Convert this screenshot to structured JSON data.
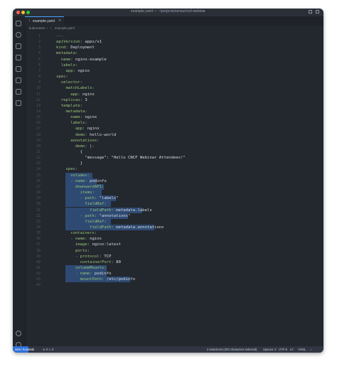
{
  "window": {
    "title": "example.yaml — ~/projects/sensu/cncf-webinar"
  },
  "tab": {
    "label": "example.yaml",
    "icon": "yaml-file-icon"
  },
  "breadcrumb": {
    "items": [
      "kubernetes",
      "example.yaml"
    ]
  },
  "code_lines": [
    {
      "n": "1",
      "k": "---",
      "v": ""
    },
    {
      "n": "2",
      "k": "apiVersion:",
      "v": " apps/v1"
    },
    {
      "n": "3",
      "k": "kind:",
      "v": " Deployment"
    },
    {
      "n": "4",
      "k": "metadata:",
      "v": ""
    },
    {
      "n": "5",
      "k": "  name:",
      "v": " nginx-example"
    },
    {
      "n": "6",
      "k": "  labels:",
      "v": ""
    },
    {
      "n": "7",
      "k": "    app:",
      "v": " nginx"
    },
    {
      "n": "8",
      "k": "spec:",
      "v": ""
    },
    {
      "n": "9",
      "k": "  selector:",
      "v": ""
    },
    {
      "n": "10",
      "k": "    matchLabels:",
      "v": ""
    },
    {
      "n": "11",
      "k": "      app:",
      "v": " nginx"
    },
    {
      "n": "12",
      "k": "  replicas:",
      "v": " 3"
    },
    {
      "n": "13",
      "k": "  template:",
      "v": ""
    },
    {
      "n": "14",
      "k": "    metadata:",
      "v": ""
    },
    {
      "n": "15",
      "k": "      name:",
      "v": " nginx"
    },
    {
      "n": "16",
      "k": "      labels:",
      "v": ""
    },
    {
      "n": "17",
      "k": "        app:",
      "v": " nginx"
    },
    {
      "n": "18",
      "k": "        demo:",
      "v": " hello-world"
    },
    {
      "n": "19",
      "k": "      annotations:",
      "v": ""
    },
    {
      "n": "20",
      "k": "        demo:",
      "v": " |-"
    },
    {
      "n": "21",
      "k": "",
      "v": "          {"
    },
    {
      "n": "22",
      "k": "",
      "v": "            \"message\": \"Hello CNCF Webinar Attendees!\""
    },
    {
      "n": "23",
      "k": "",
      "v": "          }"
    },
    {
      "n": "24",
      "k": "    spec:",
      "v": ""
    },
    {
      "n": "25",
      "k": "      volumes:",
      "v": ""
    },
    {
      "n": "26",
      "k": "      - name:",
      "v": " podinfo"
    },
    {
      "n": "27",
      "k": "        downwardAPI:",
      "v": ""
    },
    {
      "n": "28",
      "k": "          items:",
      "v": ""
    },
    {
      "n": "29",
      "k": "          - path:",
      "v": " \"labels\""
    },
    {
      "n": "30",
      "k": "            fieldRef:",
      "v": ""
    },
    {
      "n": "31",
      "k": "              fieldPath:",
      "v": " metadata.labels"
    },
    {
      "n": "32",
      "k": "          - path:",
      "v": " \"annotations\""
    },
    {
      "n": "33",
      "k": "            fieldRef:",
      "v": ""
    },
    {
      "n": "34",
      "k": "              fieldPath:",
      "v": " metadata.annotations"
    },
    {
      "n": "35",
      "k": "      containers:",
      "v": ""
    },
    {
      "n": "36",
      "k": "      - name:",
      "v": " nginx"
    },
    {
      "n": "37",
      "k": "        image:",
      "v": " nginx:latest"
    },
    {
      "n": "38",
      "k": "        ports:",
      "v": ""
    },
    {
      "n": "39",
      "k": "        - protocol:",
      "v": " TCP"
    },
    {
      "n": "40",
      "k": "          containerPort:",
      "v": " 80"
    },
    {
      "n": "41",
      "k": "        volumeMounts:",
      "v": ""
    },
    {
      "n": "42",
      "k": "        - name:",
      "v": " podinfo"
    },
    {
      "n": "43",
      "k": "          mountPath:",
      "v": " /etc/podinfo"
    },
    {
      "n": "44",
      "k": "",
      "v": ""
    }
  ],
  "status": {
    "remote": "SSH: homelab",
    "problems": "⊘ 0 ⚠ 0",
    "selection": "2 selections (303 characters selected)",
    "spaces": "Spaces: 2",
    "encoding": "UTF-8",
    "eol": "LF",
    "language": "YAML"
  },
  "colors": {
    "key": "#98c379",
    "value": "#d7dae0",
    "selection": "#2e4a72",
    "accent": "#2f6fd8"
  }
}
